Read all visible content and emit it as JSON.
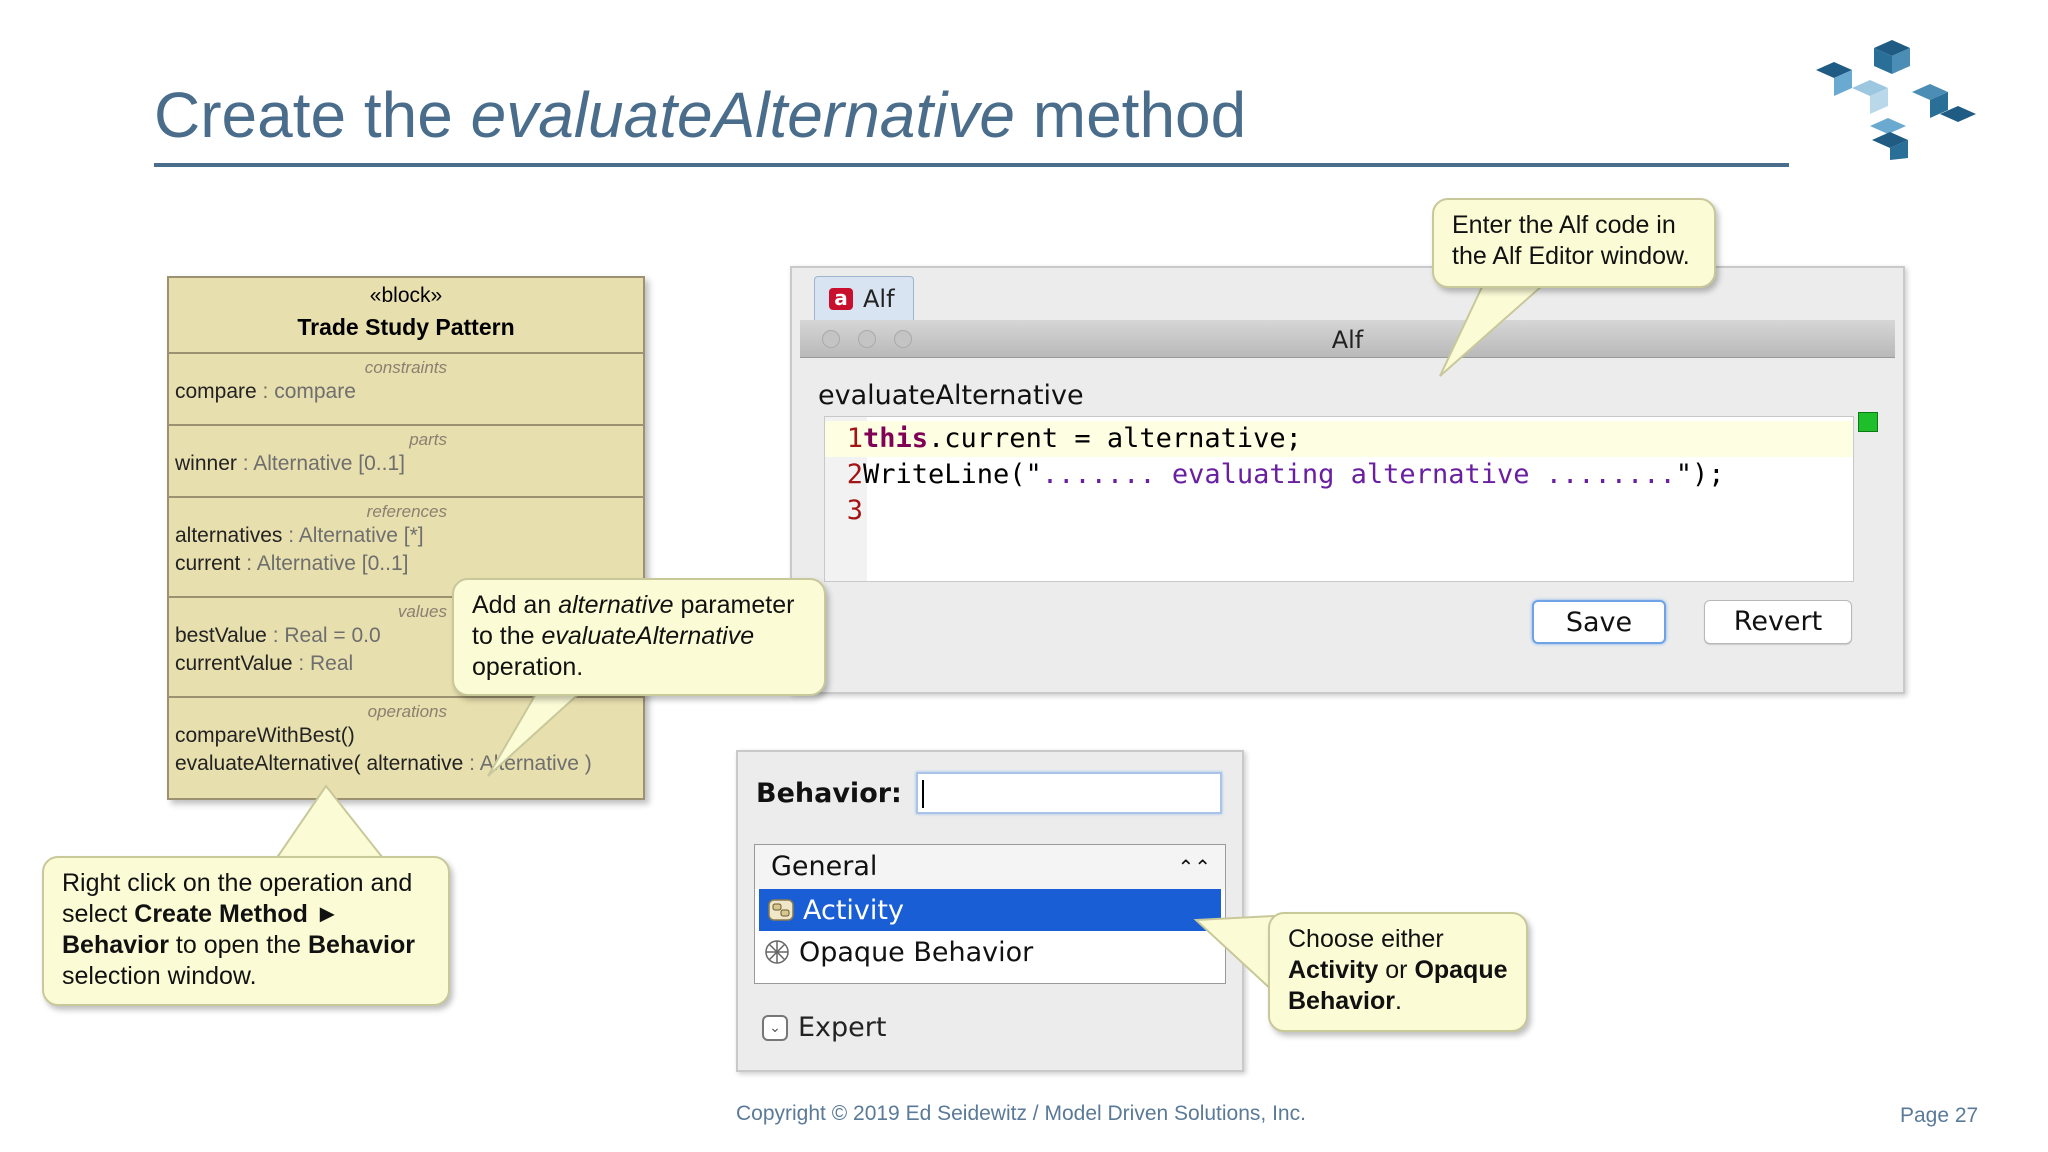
{
  "slide": {
    "title_prefix": "Create the ",
    "title_emphasis": "evaluateAlternative",
    "title_suffix": " method",
    "colors": {
      "title": "#4a6d8c",
      "callout_bg": "#fbfbd6",
      "uml_bg": "#e8dfae",
      "selection": "#1a5ed6"
    }
  },
  "uml_block": {
    "stereotype": "«block»",
    "name": "Trade Study Pattern",
    "compartments": [
      {
        "title": "constraints",
        "rows": [
          {
            "name": "compare",
            "type": " : compare"
          }
        ]
      },
      {
        "title": "parts",
        "rows": [
          {
            "name": "winner",
            "type": " : Alternative [0..1]"
          }
        ]
      },
      {
        "title": "references",
        "rows": [
          {
            "name": "alternatives",
            "type": " : Alternative [*]"
          },
          {
            "name": "current",
            "type": " : Alternative [0..1]"
          }
        ]
      },
      {
        "title": "values",
        "rows": [
          {
            "name": "bestValue",
            "type": " : Real = 0.0"
          },
          {
            "name": "currentValue",
            "type": " : Real"
          }
        ]
      },
      {
        "title": "operations",
        "rows": [
          {
            "name": "compareWithBest()",
            "type": ""
          },
          {
            "name": "evaluateAlternative( alternative",
            "type": " : Alternative )"
          }
        ]
      }
    ]
  },
  "callouts": {
    "alf_hint": "Enter the Alf code in the Alf Editor window.",
    "param": {
      "pre": "Add an ",
      "em1": "alternative",
      "mid": " parameter to the ",
      "em2": "evaluateAlternative",
      "post": " operation."
    },
    "right_click": {
      "t1": "Right click on the operation and select ",
      "b1": "Create Method ► Behavior",
      "t2": " to open the ",
      "b2": "Behavior",
      "t3": " selection window."
    },
    "choose": {
      "t1": "Choose either ",
      "b1": "Activity",
      "t2": " or ",
      "b2": "Opaque Behavior",
      "t3": "."
    }
  },
  "alf_editor": {
    "tab_label": "Alf",
    "window_title": "Alf",
    "operation_name": "evaluateAlternative",
    "lines": [
      {
        "num": "1",
        "kw": "this",
        "text": ".current = alternative;"
      },
      {
        "num": "2",
        "pre": "WriteLine(\"",
        "str": "....... evaluating alternative ........",
        "post": "\");"
      },
      {
        "num": "3",
        "text": ""
      }
    ],
    "save_label": "Save",
    "revert_label": "Revert"
  },
  "behavior_dialog": {
    "label": "Behavior:",
    "input_value": "",
    "group_label": "General",
    "items": [
      {
        "label": "Activity",
        "icon": "activity-icon",
        "selected": true
      },
      {
        "label": "Opaque Behavior",
        "icon": "opaque-behavior-icon",
        "selected": false
      }
    ],
    "expert_label": "Expert"
  },
  "footer": {
    "copyright": "Copyright © 2019 Ed Seidewitz / Model Driven Solutions, Inc.",
    "page": "Page 27"
  }
}
